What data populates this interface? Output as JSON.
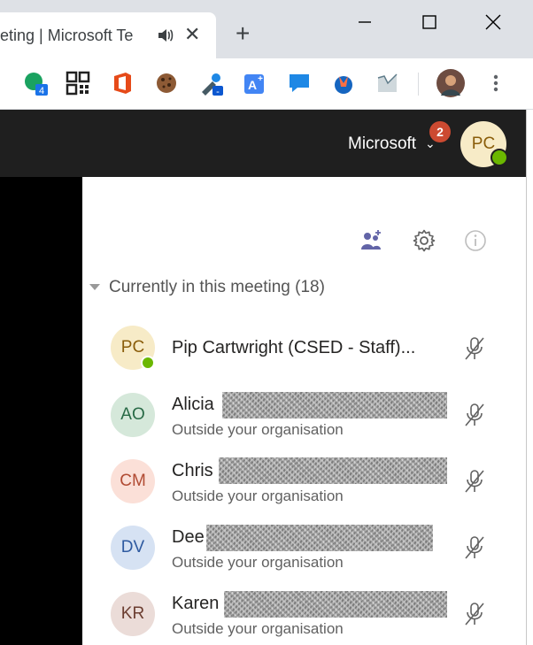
{
  "browser": {
    "tab_title": "eting | Microsoft Te",
    "new_tab_symbol": "+",
    "close_symbol": "✕",
    "extensions": [
      {
        "icon": "green-extension-icon",
        "badge": "4"
      },
      {
        "icon": "qr-code-icon"
      },
      {
        "icon": "office-icon"
      },
      {
        "icon": "cookie-icon"
      },
      {
        "icon": "eyedropper-icon",
        "badge": "-"
      },
      {
        "icon": "translate-icon"
      },
      {
        "icon": "chat-icon"
      },
      {
        "icon": "fox-icon"
      },
      {
        "icon": "graph-icon"
      },
      {
        "icon": "profile-avatar-icon"
      },
      {
        "icon": "more-vert-icon"
      }
    ]
  },
  "teams_header": {
    "org": "Microsoft",
    "notification_count": "2",
    "user_initials": "PC"
  },
  "panel": {
    "section_title": "Currently in this meeting",
    "section_count": "(18)",
    "participants": [
      {
        "initials": "PC",
        "name": "Pip Cartwright (CSED - Staff)...",
        "subtitle": "",
        "avatar_bg": "#f7ebc7",
        "avatar_fg": "#8a5d0a",
        "status": "available"
      },
      {
        "initials": "AO",
        "name": "Alicia",
        "subtitle": "Outside your organisation",
        "avatar_bg": "#d5e8da",
        "avatar_fg": "#286a46"
      },
      {
        "initials": "CM",
        "name": "Chris",
        "subtitle": "Outside your organisation",
        "avatar_bg": "#fbe0d8",
        "avatar_fg": "#b14b33"
      },
      {
        "initials": "DV",
        "name": "Dee",
        "subtitle": "Outside your organisation",
        "avatar_bg": "#d6e2f3",
        "avatar_fg": "#2e5aa0"
      },
      {
        "initials": "KR",
        "name": "Karen",
        "subtitle": "Outside your organisation",
        "avatar_bg": "#ebdcd8",
        "avatar_fg": "#6b3d30"
      }
    ]
  },
  "colors": {
    "header_bg": "#1f1f1f",
    "badge": "#cc4a31",
    "presence_available": "#6bb700",
    "accent": "#6264a7"
  }
}
